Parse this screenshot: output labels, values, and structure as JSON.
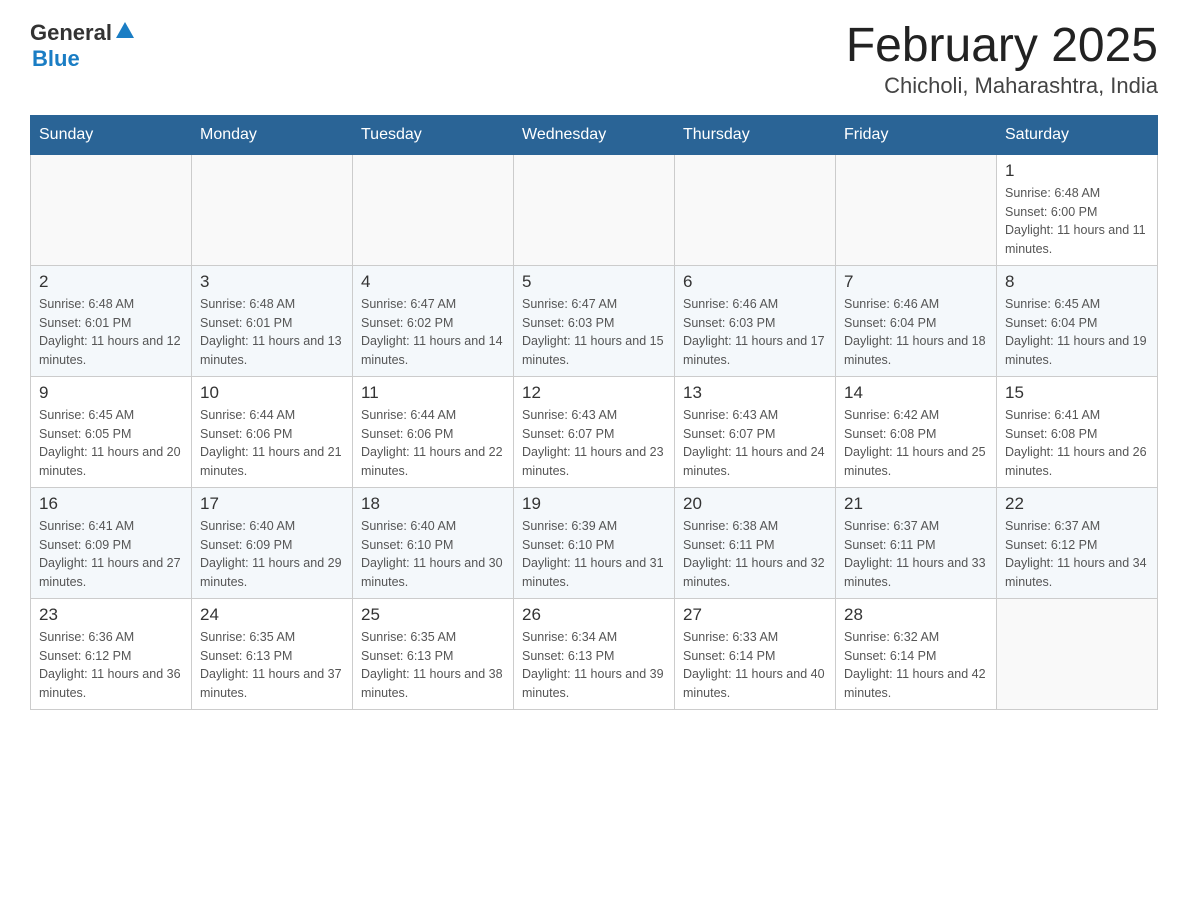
{
  "logo": {
    "general": "General",
    "blue": "Blue",
    "arrow": "▲"
  },
  "header": {
    "month": "February 2025",
    "location": "Chicholi, Maharashtra, India"
  },
  "weekdays": [
    "Sunday",
    "Monday",
    "Tuesday",
    "Wednesday",
    "Thursday",
    "Friday",
    "Saturday"
  ],
  "weeks": [
    [
      {
        "day": "",
        "sunrise": "",
        "sunset": "",
        "daylight": ""
      },
      {
        "day": "",
        "sunrise": "",
        "sunset": "",
        "daylight": ""
      },
      {
        "day": "",
        "sunrise": "",
        "sunset": "",
        "daylight": ""
      },
      {
        "day": "",
        "sunrise": "",
        "sunset": "",
        "daylight": ""
      },
      {
        "day": "",
        "sunrise": "",
        "sunset": "",
        "daylight": ""
      },
      {
        "day": "",
        "sunrise": "",
        "sunset": "",
        "daylight": ""
      },
      {
        "day": "1",
        "sunrise": "Sunrise: 6:48 AM",
        "sunset": "Sunset: 6:00 PM",
        "daylight": "Daylight: 11 hours and 11 minutes."
      }
    ],
    [
      {
        "day": "2",
        "sunrise": "Sunrise: 6:48 AM",
        "sunset": "Sunset: 6:01 PM",
        "daylight": "Daylight: 11 hours and 12 minutes."
      },
      {
        "day": "3",
        "sunrise": "Sunrise: 6:48 AM",
        "sunset": "Sunset: 6:01 PM",
        "daylight": "Daylight: 11 hours and 13 minutes."
      },
      {
        "day": "4",
        "sunrise": "Sunrise: 6:47 AM",
        "sunset": "Sunset: 6:02 PM",
        "daylight": "Daylight: 11 hours and 14 minutes."
      },
      {
        "day": "5",
        "sunrise": "Sunrise: 6:47 AM",
        "sunset": "Sunset: 6:03 PM",
        "daylight": "Daylight: 11 hours and 15 minutes."
      },
      {
        "day": "6",
        "sunrise": "Sunrise: 6:46 AM",
        "sunset": "Sunset: 6:03 PM",
        "daylight": "Daylight: 11 hours and 17 minutes."
      },
      {
        "day": "7",
        "sunrise": "Sunrise: 6:46 AM",
        "sunset": "Sunset: 6:04 PM",
        "daylight": "Daylight: 11 hours and 18 minutes."
      },
      {
        "day": "8",
        "sunrise": "Sunrise: 6:45 AM",
        "sunset": "Sunset: 6:04 PM",
        "daylight": "Daylight: 11 hours and 19 minutes."
      }
    ],
    [
      {
        "day": "9",
        "sunrise": "Sunrise: 6:45 AM",
        "sunset": "Sunset: 6:05 PM",
        "daylight": "Daylight: 11 hours and 20 minutes."
      },
      {
        "day": "10",
        "sunrise": "Sunrise: 6:44 AM",
        "sunset": "Sunset: 6:06 PM",
        "daylight": "Daylight: 11 hours and 21 minutes."
      },
      {
        "day": "11",
        "sunrise": "Sunrise: 6:44 AM",
        "sunset": "Sunset: 6:06 PM",
        "daylight": "Daylight: 11 hours and 22 minutes."
      },
      {
        "day": "12",
        "sunrise": "Sunrise: 6:43 AM",
        "sunset": "Sunset: 6:07 PM",
        "daylight": "Daylight: 11 hours and 23 minutes."
      },
      {
        "day": "13",
        "sunrise": "Sunrise: 6:43 AM",
        "sunset": "Sunset: 6:07 PM",
        "daylight": "Daylight: 11 hours and 24 minutes."
      },
      {
        "day": "14",
        "sunrise": "Sunrise: 6:42 AM",
        "sunset": "Sunset: 6:08 PM",
        "daylight": "Daylight: 11 hours and 25 minutes."
      },
      {
        "day": "15",
        "sunrise": "Sunrise: 6:41 AM",
        "sunset": "Sunset: 6:08 PM",
        "daylight": "Daylight: 11 hours and 26 minutes."
      }
    ],
    [
      {
        "day": "16",
        "sunrise": "Sunrise: 6:41 AM",
        "sunset": "Sunset: 6:09 PM",
        "daylight": "Daylight: 11 hours and 27 minutes."
      },
      {
        "day": "17",
        "sunrise": "Sunrise: 6:40 AM",
        "sunset": "Sunset: 6:09 PM",
        "daylight": "Daylight: 11 hours and 29 minutes."
      },
      {
        "day": "18",
        "sunrise": "Sunrise: 6:40 AM",
        "sunset": "Sunset: 6:10 PM",
        "daylight": "Daylight: 11 hours and 30 minutes."
      },
      {
        "day": "19",
        "sunrise": "Sunrise: 6:39 AM",
        "sunset": "Sunset: 6:10 PM",
        "daylight": "Daylight: 11 hours and 31 minutes."
      },
      {
        "day": "20",
        "sunrise": "Sunrise: 6:38 AM",
        "sunset": "Sunset: 6:11 PM",
        "daylight": "Daylight: 11 hours and 32 minutes."
      },
      {
        "day": "21",
        "sunrise": "Sunrise: 6:37 AM",
        "sunset": "Sunset: 6:11 PM",
        "daylight": "Daylight: 11 hours and 33 minutes."
      },
      {
        "day": "22",
        "sunrise": "Sunrise: 6:37 AM",
        "sunset": "Sunset: 6:12 PM",
        "daylight": "Daylight: 11 hours and 34 minutes."
      }
    ],
    [
      {
        "day": "23",
        "sunrise": "Sunrise: 6:36 AM",
        "sunset": "Sunset: 6:12 PM",
        "daylight": "Daylight: 11 hours and 36 minutes."
      },
      {
        "day": "24",
        "sunrise": "Sunrise: 6:35 AM",
        "sunset": "Sunset: 6:13 PM",
        "daylight": "Daylight: 11 hours and 37 minutes."
      },
      {
        "day": "25",
        "sunrise": "Sunrise: 6:35 AM",
        "sunset": "Sunset: 6:13 PM",
        "daylight": "Daylight: 11 hours and 38 minutes."
      },
      {
        "day": "26",
        "sunrise": "Sunrise: 6:34 AM",
        "sunset": "Sunset: 6:13 PM",
        "daylight": "Daylight: 11 hours and 39 minutes."
      },
      {
        "day": "27",
        "sunrise": "Sunrise: 6:33 AM",
        "sunset": "Sunset: 6:14 PM",
        "daylight": "Daylight: 11 hours and 40 minutes."
      },
      {
        "day": "28",
        "sunrise": "Sunrise: 6:32 AM",
        "sunset": "Sunset: 6:14 PM",
        "daylight": "Daylight: 11 hours and 42 minutes."
      },
      {
        "day": "",
        "sunrise": "",
        "sunset": "",
        "daylight": ""
      }
    ]
  ]
}
